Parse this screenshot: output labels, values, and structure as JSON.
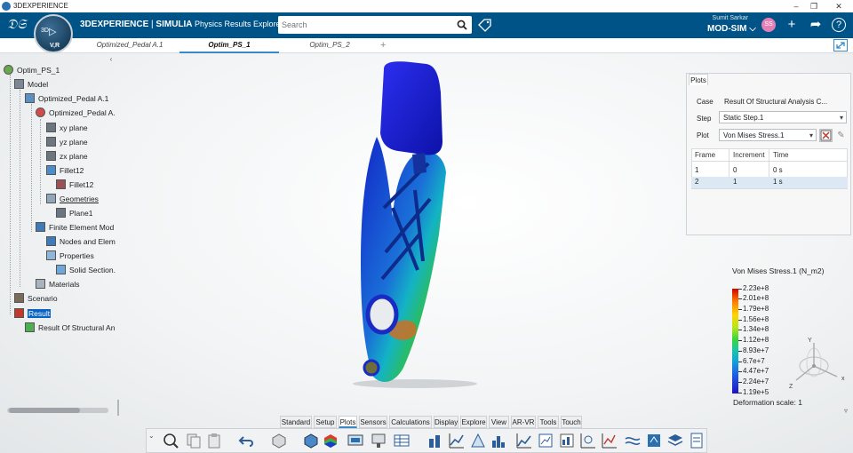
{
  "window": {
    "title": "3DEXPERIENCE"
  },
  "brand": {
    "prefix": "3D",
    "experience": "EXPERIENCE",
    "sep": " | ",
    "company": "SIMULIA",
    "app": " Physics Results Explorer"
  },
  "compass": {
    "top": "3D",
    "version": "V,R"
  },
  "search": {
    "placeholder": "Search"
  },
  "user": {
    "name": "Sumit Sarkar",
    "workspace": "MOD-SIM",
    "initials": "SS"
  },
  "tabs": [
    {
      "label": "Optimized_Pedal A.1"
    },
    {
      "label": "Optim_PS_1",
      "active": true
    },
    {
      "label": "Optim_PS_2"
    }
  ],
  "tab_add": "+",
  "tree": {
    "collapse": "‹",
    "nodes": [
      "Optim_PS_1",
      "Model",
      "Optimized_Pedal A.1",
      "Optimized_Pedal A.",
      "xy plane",
      "yz plane",
      "zx plane",
      "Fillet12",
      "Fillet12",
      "Geometries",
      "Plane1",
      "Finite Element Mod",
      "Nodes and Elem",
      "Properties",
      "Solid Section.",
      "Materials",
      "Scenario",
      "Result",
      "Result Of Structural An"
    ]
  },
  "plots": {
    "tab": "Plots",
    "case_label": "Case",
    "case_value": "Result Of Structural Analysis C...",
    "step_label": "Step",
    "step_value": "Static Step.1",
    "plot_label": "Plot",
    "plot_value": "Von Mises Stress.1",
    "columns": [
      "Frame",
      "Increment",
      "Time"
    ],
    "rows": [
      [
        "1",
        "0",
        "0 s"
      ],
      [
        "2",
        "1",
        "1 s"
      ]
    ],
    "selected_row": 2
  },
  "legend": {
    "title": "Von Mises Stress.1 (N_m2)",
    "values": [
      "2.23e+8",
      "2.01e+8",
      "1.79e+8",
      "1.56e+8",
      "1.34e+8",
      "1.12e+8",
      "8.93e+7",
      "6.7e+7",
      "4.47e+7",
      "2.24e+7",
      "1.19e+5"
    ],
    "deformation_scale": "Deformation scale: 1"
  },
  "triad": {
    "x": "x",
    "y": "Y",
    "z": "Z"
  },
  "toolbar_tabs": [
    "Standard",
    "Setup",
    "Plots",
    "Sensors",
    "Calculations",
    "Display",
    "Explore",
    "View",
    "AR-VR",
    "Tools",
    "Touch"
  ],
  "toolbar_active": "Plots",
  "colors": {
    "topbar": "#005386",
    "accent": "#3a88c8",
    "selection": "#0a63c2"
  }
}
